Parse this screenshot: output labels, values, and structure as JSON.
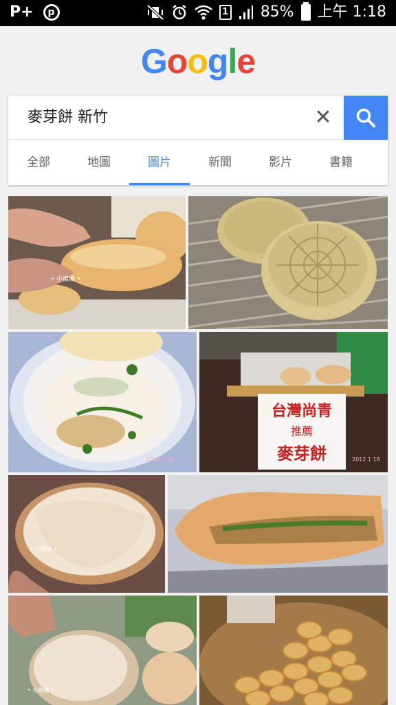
{
  "status_bar": {
    "left_icon": "P+",
    "pinterest_icon": "p",
    "sim_slot": "1",
    "battery": "85%",
    "time": "上午 1:18"
  },
  "logo": {
    "letters": [
      "G",
      "o",
      "o",
      "g",
      "l",
      "e"
    ],
    "colors": [
      "#4285f4",
      "#ea4335",
      "#fbbc05",
      "#4285f4",
      "#34a853",
      "#ea4335"
    ]
  },
  "search": {
    "query": "麥芽餅 新竹",
    "clear_symbol": "✕"
  },
  "tabs": [
    "全部",
    "地圖",
    "圖片",
    "新聞",
    "影片",
    "書籍"
  ],
  "active_tab": "圖片",
  "images": [
    {
      "name": "image-hand-holding-pastry",
      "watermark": "• 小燒鳩 •"
    },
    {
      "name": "image-flower-shaped-cakes"
    },
    {
      "name": "image-plated-pastry-with-herbs",
      "watermark": "2012 1 18"
    },
    {
      "name": "image-street-stall-sign",
      "sign_line1": "台灣尚青",
      "sign_line2": "推薦",
      "sign_line3": "麥芽餅",
      "watermark": "2012 1 18"
    },
    {
      "name": "image-open-pastry-filling",
      "watermark": "• 小燒鳩 •"
    },
    {
      "name": "image-cut-pastry-cross-section"
    },
    {
      "name": "image-bagged-buns",
      "watermark": "• 小燒鳩 •"
    },
    {
      "name": "image-basket-of-biscuits"
    }
  ]
}
